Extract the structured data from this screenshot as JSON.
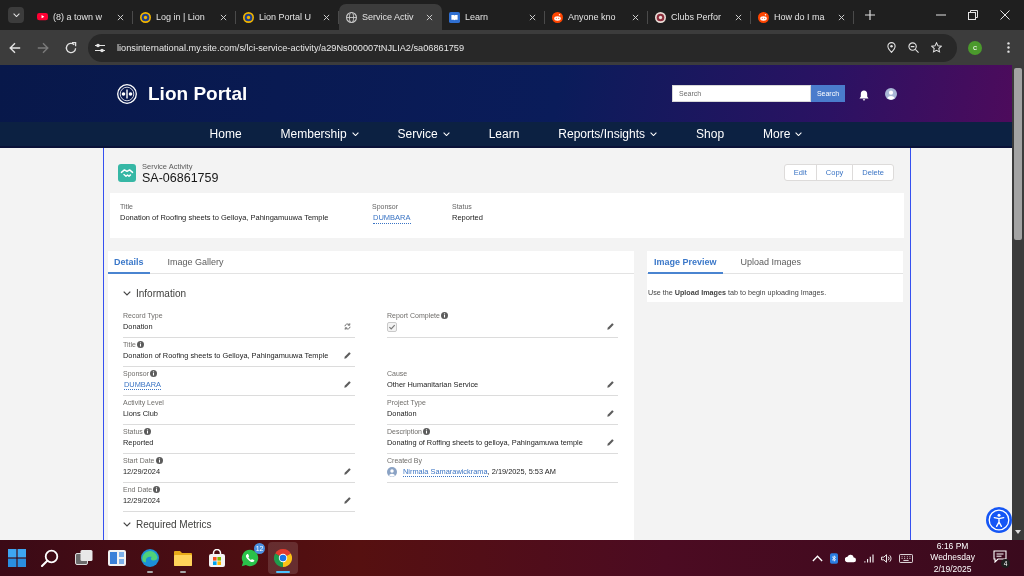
{
  "browser": {
    "tabs": [
      {
        "kind": "youtube",
        "title": "(8) a town w",
        "selected": false
      },
      {
        "kind": "lions",
        "title": "Log in | Lion",
        "selected": false
      },
      {
        "kind": "lions",
        "title": "Lion Portal U",
        "selected": false
      },
      {
        "kind": "globe",
        "title": "Service Activ",
        "selected": true
      },
      {
        "kind": "learn",
        "title": "Learn",
        "selected": false
      },
      {
        "kind": "reddit",
        "title": "Anyone kno",
        "selected": false
      },
      {
        "kind": "clubs",
        "title": "Clubs Perfor",
        "selected": false
      },
      {
        "kind": "reddit",
        "title": "How do I ma",
        "selected": false
      }
    ],
    "url": "lionsinternational.my.site.com/s/lci-service-activity/a29Ns000007tNJLIA2/sa06861759",
    "profile_initial": "c"
  },
  "site": {
    "brand": "Lion Portal",
    "search": {
      "placeholder": "Search",
      "button": "Search"
    },
    "nav": [
      {
        "label": "Home",
        "has_menu": false
      },
      {
        "label": "Membership",
        "has_menu": true
      },
      {
        "label": "Service",
        "has_menu": true
      },
      {
        "label": "Learn",
        "has_menu": false
      },
      {
        "label": "Reports/Insights",
        "has_menu": true
      },
      {
        "label": "Shop",
        "has_menu": false
      },
      {
        "label": "More",
        "has_menu": true
      }
    ]
  },
  "record": {
    "object_type": "Service Activity",
    "name": "SA-06861759",
    "actions": [
      "Edit",
      "Copy",
      "Delete"
    ],
    "highlights": [
      {
        "label": "Title",
        "value": "Donation of Roofing sheets to Gelloya, Pahingamuuwa Temple",
        "kind": "text"
      },
      {
        "label": "Sponsor",
        "value": "DUMBARA",
        "kind": "link"
      },
      {
        "label": "Status",
        "value": "Reported",
        "kind": "text"
      }
    ]
  },
  "details_card": {
    "tabs": [
      {
        "label": "Details",
        "selected": true
      },
      {
        "label": "Image Gallery",
        "selected": false
      }
    ],
    "sections": [
      {
        "title": "Information",
        "expanded": true,
        "rows": [
          {
            "left": {
              "label": "Record Type",
              "kind": "record_type",
              "value": "Donation",
              "info": false,
              "editable": false
            },
            "right": {
              "label": "Report Complete",
              "kind": "checkbox",
              "checked": true,
              "info": true,
              "editable": true
            }
          },
          {
            "left": {
              "label": "Title",
              "kind": "text",
              "value": "Donation of Roofing sheets to Gelloya, Pahingamuuwa Temple",
              "info": true,
              "editable": true
            }
          },
          {
            "left": {
              "label": "Sponsor",
              "kind": "link",
              "value": "DUMBARA",
              "info": true,
              "editable": true
            },
            "right": {
              "label": "Cause",
              "kind": "text",
              "value": "Other Humanitarian Service",
              "info": false,
              "editable": true
            }
          },
          {
            "left": {
              "label": "Activity Level",
              "kind": "text",
              "value": "Lions Club",
              "info": false,
              "editable": false
            },
            "right": {
              "label": "Project Type",
              "kind": "text",
              "value": "Donation",
              "info": false,
              "editable": true
            }
          },
          {
            "left": {
              "label": "Status",
              "kind": "text",
              "value": "Reported",
              "info": true,
              "editable": false
            },
            "right": {
              "label": "Description",
              "kind": "text",
              "value": "Donating of Roffing sheets to gelloya, Pahingamuwa temple",
              "info": true,
              "editable": true
            }
          },
          {
            "left": {
              "label": "Start Date",
              "kind": "text",
              "value": "12/29/2024",
              "info": true,
              "editable": true
            },
            "right": {
              "label": "Created By",
              "kind": "user",
              "value": "Nirmala Samarawickrama",
              "suffix": ", 2/19/2025, 5:53 AM",
              "info": false,
              "editable": false
            }
          },
          {
            "left": {
              "label": "End Date",
              "kind": "text",
              "value": "12/29/2024",
              "info": true,
              "editable": true
            }
          }
        ]
      },
      {
        "title": "Required Metrics",
        "expanded": true
      }
    ]
  },
  "image_card": {
    "tabs": [
      {
        "label": "Image Preview",
        "selected": true
      },
      {
        "label": "Upload Images",
        "selected": false
      }
    ],
    "message": "Use the **Upload Images** tab to begin uploading Images."
  },
  "taskbar": {
    "apps": [
      {
        "kind": "start",
        "running": false,
        "active": false
      },
      {
        "kind": "search",
        "running": false,
        "active": false
      },
      {
        "kind": "taskview",
        "running": false,
        "active": false
      },
      {
        "kind": "widgets",
        "running": false,
        "active": false
      },
      {
        "kind": "edge",
        "running": true,
        "active": false
      },
      {
        "kind": "explorer",
        "running": true,
        "active": false
      },
      {
        "kind": "store",
        "running": false,
        "active": false
      },
      {
        "kind": "whatsapp",
        "running": false,
        "active": false,
        "badge": "12"
      },
      {
        "kind": "chrome",
        "running": true,
        "active": true
      }
    ],
    "clock": {
      "time": "6:16 PM",
      "day": "Wednesday",
      "date": "2/19/2025"
    },
    "notification_count": "4"
  }
}
